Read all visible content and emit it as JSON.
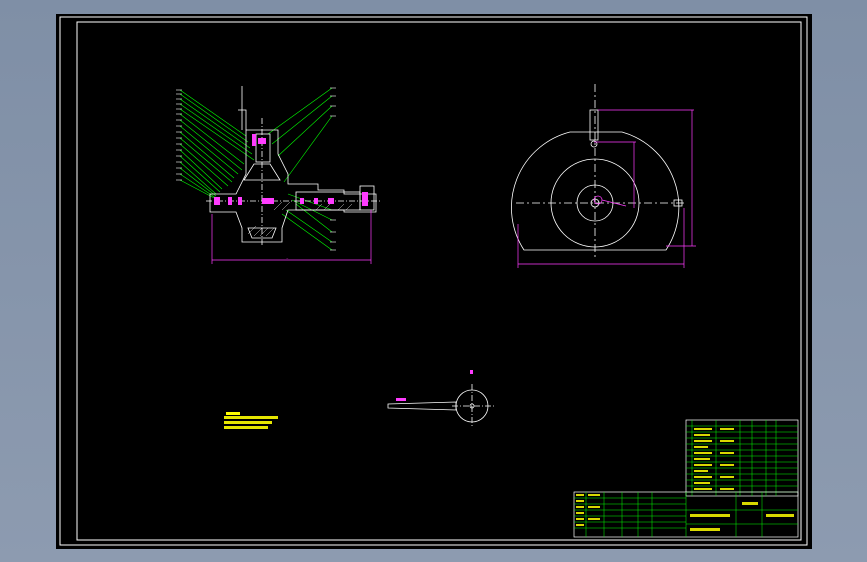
{
  "drawing": {
    "background": "#000000",
    "desktop_color": "#8896ac",
    "colors": {
      "outline": "#ffffff",
      "dimension": "#ff3cff",
      "leader": "#00ff00",
      "note": "#ffff00",
      "table_grid": "#00ff00"
    }
  },
  "views": {
    "section_view": "pump-section-view",
    "end_view": "pump-end-view",
    "detail_view": "impeller-detail-view"
  },
  "notes": {
    "technical_requirements": "notes-block"
  },
  "title_block": {
    "parts_list": "parts-list-table",
    "main_block": "title-block-table"
  }
}
